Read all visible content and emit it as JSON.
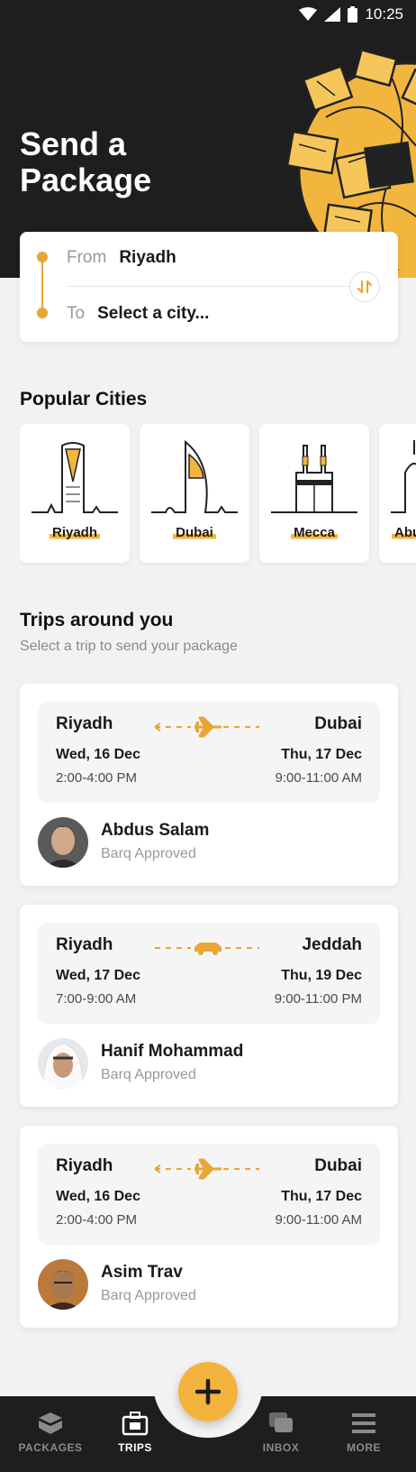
{
  "status_bar": {
    "time": "10:25"
  },
  "header": {
    "title": "Send a Package"
  },
  "route": {
    "from_label": "From",
    "from_value": "Riyadh",
    "to_label": "To",
    "to_placeholder": "Select a city..."
  },
  "popular": {
    "title": "Popular Cities",
    "cities": [
      {
        "name": "Riyadh"
      },
      {
        "name": "Dubai"
      },
      {
        "name": "Mecca"
      },
      {
        "name": "Abu Dhabi"
      }
    ]
  },
  "trips": {
    "title": "Trips around you",
    "subtitle": "Select a trip to send your package",
    "items": [
      {
        "from": "Riyadh",
        "to": "Dubai",
        "mode": "plane-icon",
        "from_date": "Wed, 16 Dec",
        "to_date": "Thu, 17 Dec",
        "from_time": "2:00-4:00 PM",
        "to_time": "9:00-11:00 AM",
        "traveler": "Abdus Salam",
        "status": "Barq Approved"
      },
      {
        "from": "Riyadh",
        "to": "Jeddah",
        "mode": "car-icon",
        "from_date": "Wed, 17 Dec",
        "to_date": "Thu, 19 Dec",
        "from_time": "7:00-9:00 AM",
        "to_time": "9:00-11:00 PM",
        "traveler": "Hanif Mohammad",
        "status": "Barq Approved"
      },
      {
        "from": "Riyadh",
        "to": "Dubai",
        "mode": "plane-icon",
        "from_date": "Wed, 16 Dec",
        "to_date": "Thu, 17 Dec",
        "from_time": "2:00-4:00 PM",
        "to_time": "9:00-11:00 AM",
        "traveler": "Asim Trav",
        "status": "Barq Approved"
      }
    ]
  },
  "nav": {
    "items": [
      {
        "label": "PACKAGES",
        "icon": "packages-icon"
      },
      {
        "label": "TRIPS",
        "icon": "trips-icon",
        "active": true
      },
      {
        "label": "INBOX",
        "icon": "inbox-icon"
      },
      {
        "label": "MORE",
        "icon": "menu-icon"
      }
    ],
    "fab_icon": "plus-icon"
  },
  "colors": {
    "accent": "#f4b33c",
    "dark": "#1e1e1e",
    "background": "#f2f2f2"
  }
}
